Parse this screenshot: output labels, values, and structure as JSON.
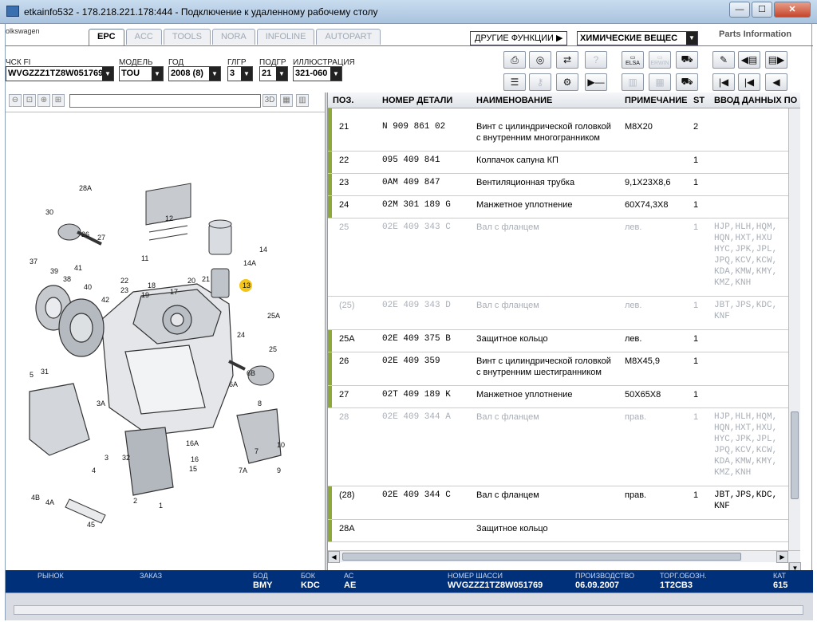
{
  "window": {
    "title": "etkainfo532 - 178.218.221.178:444 - Подключение к удаленному рабочему столу",
    "minimize": "—",
    "maximize": "☐",
    "close": "✕"
  },
  "app": {
    "brand": "olkswagen",
    "logo_text": "Parts Information",
    "tabs": [
      "EPC",
      "ACC",
      "TOOLS",
      "NORA",
      "INFOLINE",
      "AUTOPART"
    ],
    "active_tab": "EPC",
    "other_functions": "ДРУГИЕ ФУНКЦИИ",
    "chem_select": "ХИМИЧЕСКИЕ ВЕЩЕС"
  },
  "filters": {
    "vin_label": "ЧСК FI",
    "vin_value": "WVGZZZ1TZ8W051769",
    "model_label": "МОДЕЛЬ",
    "model_value": "TOU",
    "year_label": "ГОД",
    "year_value": "2008 (8)",
    "mgroup_label": "ГЛГР",
    "mgroup_value": "3",
    "subgroup_label": "ПОДГР",
    "subgroup_value": "21",
    "illustration_label": "ИЛЛЮСТРАЦИЯ",
    "illustration_value": "321-060"
  },
  "toolbar_icons": {
    "row1": [
      "print-icon",
      "disc-icon",
      "car-swap-icon",
      "help-icon",
      "elsa-icon",
      "erwin-icon",
      "cart-icon",
      "pin-icon",
      "book-prev-icon",
      "book-next-icon"
    ],
    "row2": [
      "list-icon",
      "key-icon",
      "motorbike-icon",
      "play-icon",
      "module-icon",
      "component-icon",
      "cart-add-icon",
      "first-icon",
      "prev-icon",
      "back-icon"
    ],
    "elsa_label": "ELSA",
    "erwin_label": "ERWIN"
  },
  "illustration_toolbar": {
    "three_d": "3D"
  },
  "grid": {
    "headers": {
      "pos": "ПОЗ.",
      "part_no": "НОМЕР ДЕТАЛИ",
      "name": "НАИМЕНОВАНИЕ",
      "note": "ПРИМЕЧАНИЕ",
      "st": "ST",
      "input": "ВВОД ДАННЫХ ПО"
    },
    "rows": [
      {
        "pos": "21",
        "part": "N   909 861 02",
        "name": "Винт с цилиндрической головкой",
        "name2": "с внутренним многогранником",
        "note": "M8X20",
        "st": "2",
        "model": "",
        "model2": "",
        "model3": "",
        "model4": "",
        "model5": "",
        "model6": ""
      },
      {
        "pos": "22",
        "part": "095 409 841",
        "name": "Колпачок сапуна КП",
        "name2": "",
        "note": "",
        "st": "1",
        "model": "",
        "model2": "",
        "model3": "",
        "model4": "",
        "model5": "",
        "model6": ""
      },
      {
        "pos": "23",
        "part": "0AM 409 847",
        "name": "Вентиляционная трубка",
        "name2": "",
        "note": "9,1X23X8,6",
        "st": "1",
        "model": "",
        "model2": "",
        "model3": "",
        "model4": "",
        "model5": "",
        "model6": ""
      },
      {
        "pos": "24",
        "part": "02M 301 189 G",
        "name": "Манжетное уплотнение",
        "name2": "",
        "note": "60X74,3X8",
        "st": "1",
        "model": "",
        "model2": "",
        "model3": "",
        "model4": "",
        "model5": "",
        "model6": ""
      },
      {
        "pos": "25",
        "part": "02E 409 343 C",
        "name": "Вал с фланцем",
        "name2": "",
        "note": "лев.",
        "st": "1",
        "model": "HJP,HLH,HQM,",
        "model2": "HQN,HXT,HXU",
        "model3": "HYC,JPK,JPL,",
        "model4": "JPQ,KCV,KCW,",
        "model5": "KDA,KMW,KMY,",
        "model6": "KMZ,KNH"
      },
      {
        "pos": "(25)",
        "part": "02E 409 343 D",
        "name": "Вал с фланцем",
        "name2": "",
        "note": "лев.",
        "st": "1",
        "model": "JBT,JPS,KDC,",
        "model2": "KNF",
        "model3": "",
        "model4": "",
        "model5": "",
        "model6": ""
      },
      {
        "pos": "25A",
        "part": "02E 409 375 B",
        "name": "Защитное кольцо",
        "name2": "",
        "note": "лев.",
        "st": "1",
        "model": "",
        "model2": "",
        "model3": "",
        "model4": "",
        "model5": "",
        "model6": ""
      },
      {
        "pos": "26",
        "part": "02E 409 359",
        "name": "Винт с цилиндрической головкой",
        "name2": "с внутренним шестигранником",
        "note": "M8X45,9",
        "st": "1",
        "model": "",
        "model2": "",
        "model3": "",
        "model4": "",
        "model5": "",
        "model6": ""
      },
      {
        "pos": "27",
        "part": "02T 409 189 K",
        "name": "Манжетное уплотнение",
        "name2": "",
        "note": "50X65X8",
        "st": "1",
        "model": "",
        "model2": "",
        "model3": "",
        "model4": "",
        "model5": "",
        "model6": ""
      },
      {
        "pos": "28",
        "part": "02E 409 344 A",
        "name": "Вал с фланцем",
        "name2": "",
        "note": "прав.",
        "st": "1",
        "model": "HJP,HLH,HQM,",
        "model2": "HQN,HXT,HXU,",
        "model3": "HYC,JPK,JPL,",
        "model4": "JPQ,KCV,KCW,",
        "model5": "KDA,KMW,KMY,",
        "model6": "KMZ,KNH"
      },
      {
        "pos": "(28)",
        "part": "02E 409 344 C",
        "name": "Вал с фланцем",
        "name2": "",
        "note": "прав.",
        "st": "1",
        "model": "JBT,JPS,KDC,",
        "model2": "KNF",
        "model3": "",
        "model4": "",
        "model5": "",
        "model6": ""
      },
      {
        "pos": "28A",
        "part": "",
        "name": "Защитное кольцо",
        "name2": "",
        "note": "",
        "st": "",
        "model": "",
        "model2": "",
        "model3": "",
        "model4": "",
        "model5": "",
        "model6": ""
      }
    ]
  },
  "status": {
    "market_label": "РЫНОК",
    "market_value": "",
    "order_label": "ЗАКАЗ",
    "order_value": "",
    "bod_label": "БОД",
    "bod_value": "BMY",
    "bok_label": "БОК",
    "bok_value": "KDC",
    "ac_label": "АС",
    "ac_value": "AE",
    "chassis_label": "НОМЕР ШАССИ",
    "chassis_value": "WVGZZZ1TZ8W051769",
    "production_label": "ПРОИЗВОДСТВО",
    "production_value": "06.09.2007",
    "trade_label": "ТОРГ.ОБОЗН.",
    "trade_value": "1T2CB3",
    "cat_label": "КАТ",
    "cat_value": "615"
  },
  "diagram_callouts": [
    "28A",
    "30",
    "26",
    "27",
    "25A",
    "25",
    "24",
    "6B",
    "12",
    "11",
    "14",
    "14A",
    "13",
    "22",
    "23",
    "19",
    "18",
    "17",
    "20",
    "21",
    "37",
    "39",
    "38",
    "40",
    "41",
    "42",
    "5",
    "31",
    "4",
    "3A",
    "3",
    "32",
    "16A",
    "16",
    "15",
    "6A",
    "8",
    "9",
    "7",
    "7A",
    "10",
    "1",
    "2",
    "4A",
    "4B",
    "45"
  ],
  "colors": {
    "status_bg": "#00307a",
    "row_marker": "#8fa83a",
    "callout_highlight": "#f5c518"
  }
}
